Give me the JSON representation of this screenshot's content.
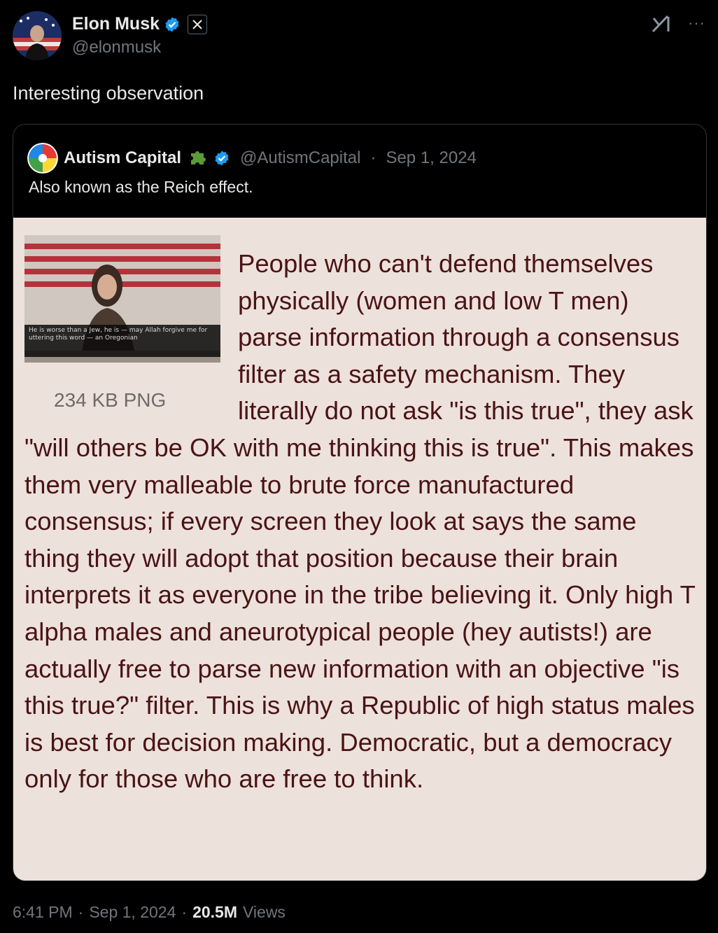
{
  "author": {
    "name": "Elon Musk",
    "handle": "@elonmusk",
    "verified_icon": "verified-badge-icon",
    "affiliate_icon": "x-logo-icon"
  },
  "toolbar": {
    "grok_icon": "grok-icon",
    "more_label": "···"
  },
  "tweet": {
    "text": "Interesting observation"
  },
  "quote": {
    "name": "Autism Capital",
    "handle": "@AutismCapital",
    "separator": "·",
    "date": "Sep 1, 2024",
    "text": "Also known as the Reich effect.",
    "image": {
      "thumb_caption": "He is worse than a Jew, he is — may Allah forgive me for uttering this word — an Oregonian",
      "thumb_size": "234 KB PNG",
      "body": "People who can't defend themselves physically (women and low T men) parse information through a consensus filter as a safety mechanism. They literally do not ask \"is this true\", they ask \"will others be OK with me thinking this is true\". This makes them very malleable to brute force manufactured consensus; if every screen they look at says the same thing they will adopt that position because their brain interprets it as everyone in the tribe believing it. Only high T alpha males and aneurotypical people (hey autists!) are actually free to parse new information with an objective \"is this true?\" filter. This is why a Republic of high status males is best for decision making. Democratic, but a democracy only for those who are free to think."
    }
  },
  "meta": {
    "time": "6:41 PM",
    "sep1": "·",
    "date": "Sep 1, 2024",
    "sep2": "·",
    "views_count": "20.5M",
    "views_label": "Views"
  },
  "colors": {
    "verified": "#1d9bf0",
    "background": "#000000",
    "meme_bg": "#ede1dc",
    "meme_text": "#4a1414"
  }
}
